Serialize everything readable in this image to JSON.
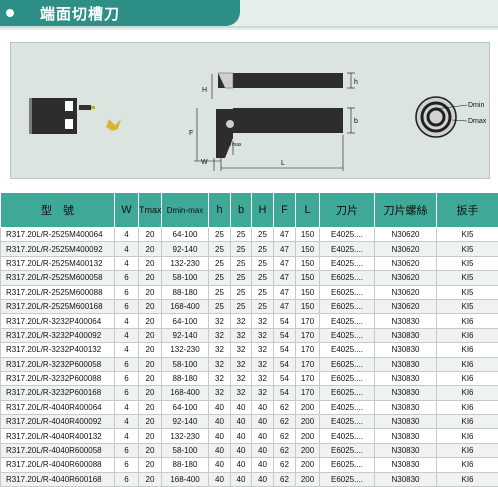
{
  "title": "端面切槽刀",
  "diagram_labels": {
    "H": "H",
    "h": "h",
    "b": "b",
    "F": "F",
    "Tmax": "Tmax",
    "W": "W",
    "L": "L",
    "Dmin": "Dmin",
    "Dmax": "Dmax"
  },
  "table": {
    "headers": [
      "型　號",
      "W",
      "Tmax",
      "Dmin-max",
      "h",
      "b",
      "H",
      "F",
      "L",
      "刀片",
      "刀片螺絲",
      "扳手"
    ],
    "rows": [
      [
        "R317.20L/R-2525M400064",
        "4",
        "20",
        "64-100",
        "25",
        "25",
        "25",
        "47",
        "150",
        "E4025....",
        "N30620",
        "KI5"
      ],
      [
        "R317.20L/R-2525M400092",
        "4",
        "20",
        "92-140",
        "25",
        "25",
        "25",
        "47",
        "150",
        "E4025....",
        "N30620",
        "KI5"
      ],
      [
        "R317.20L/R-2525M400132",
        "4",
        "20",
        "132-230",
        "25",
        "25",
        "25",
        "47",
        "150",
        "E4025....",
        "N30620",
        "KI5"
      ],
      [
        "R317.20L/R-2525M600058",
        "6",
        "20",
        "58-100",
        "25",
        "25",
        "25",
        "47",
        "150",
        "E6025....",
        "N30620",
        "KI5"
      ],
      [
        "R317.20L/R-2525M600088",
        "6",
        "20",
        "88-180",
        "25",
        "25",
        "25",
        "47",
        "150",
        "E6025....",
        "N30620",
        "KI5"
      ],
      [
        "R317.20L/R-2525M600168",
        "6",
        "20",
        "168-400",
        "25",
        "25",
        "25",
        "47",
        "150",
        "E6025....",
        "N30620",
        "KI5"
      ],
      [
        "R317.20L/R-3232P400064",
        "4",
        "20",
        "64-100",
        "32",
        "32",
        "32",
        "54",
        "170",
        "E4025....",
        "N30830",
        "KI6"
      ],
      [
        "R317.20L/R-3232P400092",
        "4",
        "20",
        "92-140",
        "32",
        "32",
        "32",
        "54",
        "170",
        "E4025....",
        "N30830",
        "KI6"
      ],
      [
        "R317.20L/R-3232P400132",
        "4",
        "20",
        "132-230",
        "32",
        "32",
        "32",
        "54",
        "170",
        "E4025....",
        "N30830",
        "KI6"
      ],
      [
        "R317.20L/R-3232P600058",
        "6",
        "20",
        "58-100",
        "32",
        "32",
        "32",
        "54",
        "170",
        "E6025....",
        "N30830",
        "KI6"
      ],
      [
        "R317.20L/R-3232P600088",
        "6",
        "20",
        "88-180",
        "32",
        "32",
        "32",
        "54",
        "170",
        "E6025....",
        "N30830",
        "KI6"
      ],
      [
        "R317.20L/R-3232P600168",
        "6",
        "20",
        "168-400",
        "32",
        "32",
        "32",
        "54",
        "170",
        "E6025....",
        "N30830",
        "KI6"
      ],
      [
        "R317.20L/R-4040R400064",
        "4",
        "20",
        "64-100",
        "40",
        "40",
        "40",
        "62",
        "200",
        "E4025....",
        "N30830",
        "KI6"
      ],
      [
        "R317.20L/R-4040R400092",
        "4",
        "20",
        "92-140",
        "40",
        "40",
        "40",
        "62",
        "200",
        "E4025....",
        "N30830",
        "KI6"
      ],
      [
        "R317.20L/R-4040R400132",
        "4",
        "20",
        "132-230",
        "40",
        "40",
        "40",
        "62",
        "200",
        "E4025....",
        "N30830",
        "KI6"
      ],
      [
        "R317.20L/R-4040R600058",
        "6",
        "20",
        "58-100",
        "40",
        "40",
        "40",
        "62",
        "200",
        "E6025....",
        "N30830",
        "KI6"
      ],
      [
        "R317.20L/R-4040R600088",
        "6",
        "20",
        "88-180",
        "40",
        "40",
        "40",
        "62",
        "200",
        "E6025....",
        "N30830",
        "KI6"
      ],
      [
        "R317.20L/R-4040R600168",
        "6",
        "20",
        "168-400",
        "40",
        "40",
        "40",
        "62",
        "200",
        "E6025....",
        "N30830",
        "KI6"
      ]
    ]
  }
}
